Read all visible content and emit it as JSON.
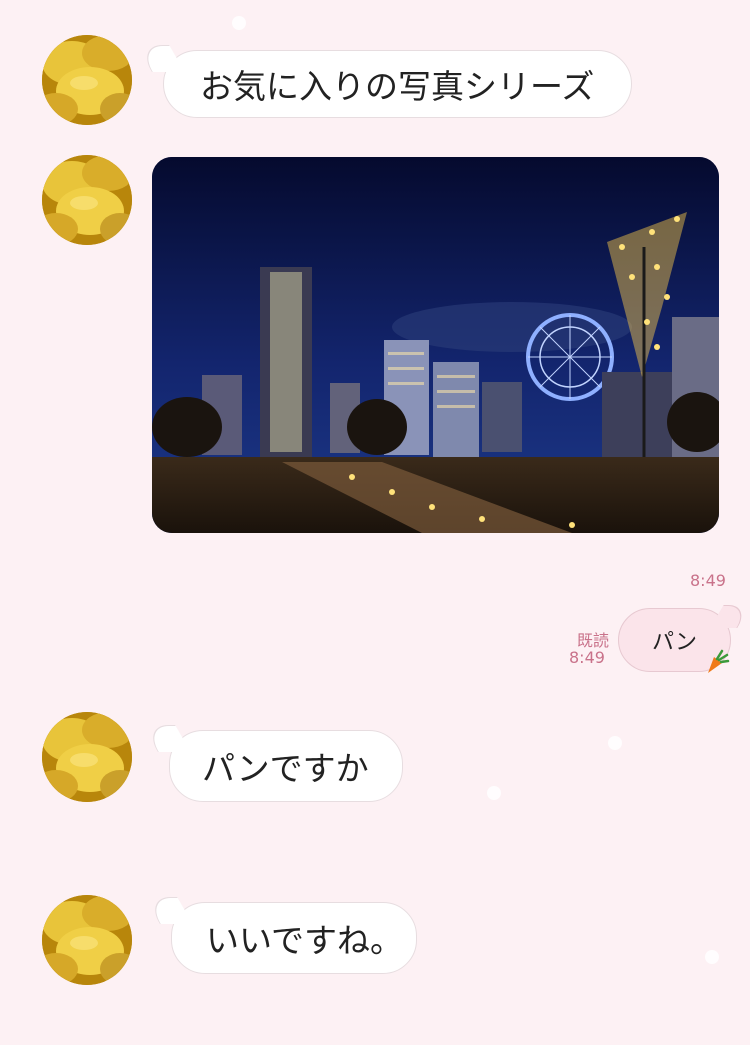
{
  "messages": [
    {
      "type": "text",
      "from": "other",
      "text": "お気に入りの写真シリーズ"
    },
    {
      "type": "image",
      "from": "other",
      "subject": "Yokohama Minato Mirai night skyline"
    },
    {
      "type": "time",
      "text": "8:49"
    },
    {
      "type": "text",
      "from": "me",
      "text": "パン",
      "read": "既読",
      "time": "8:49"
    },
    {
      "type": "text",
      "from": "other",
      "text": "パンですか"
    },
    {
      "type": "text",
      "from": "other",
      "text": "いいですね。"
    }
  ],
  "colors": {
    "background": "#fdf1f4",
    "timestamp": "#c9728a",
    "outgoing_bubble": "#fbe4ea"
  },
  "icons": {
    "avatar": "lemon-avatar",
    "sticker": "carrot-icon"
  }
}
